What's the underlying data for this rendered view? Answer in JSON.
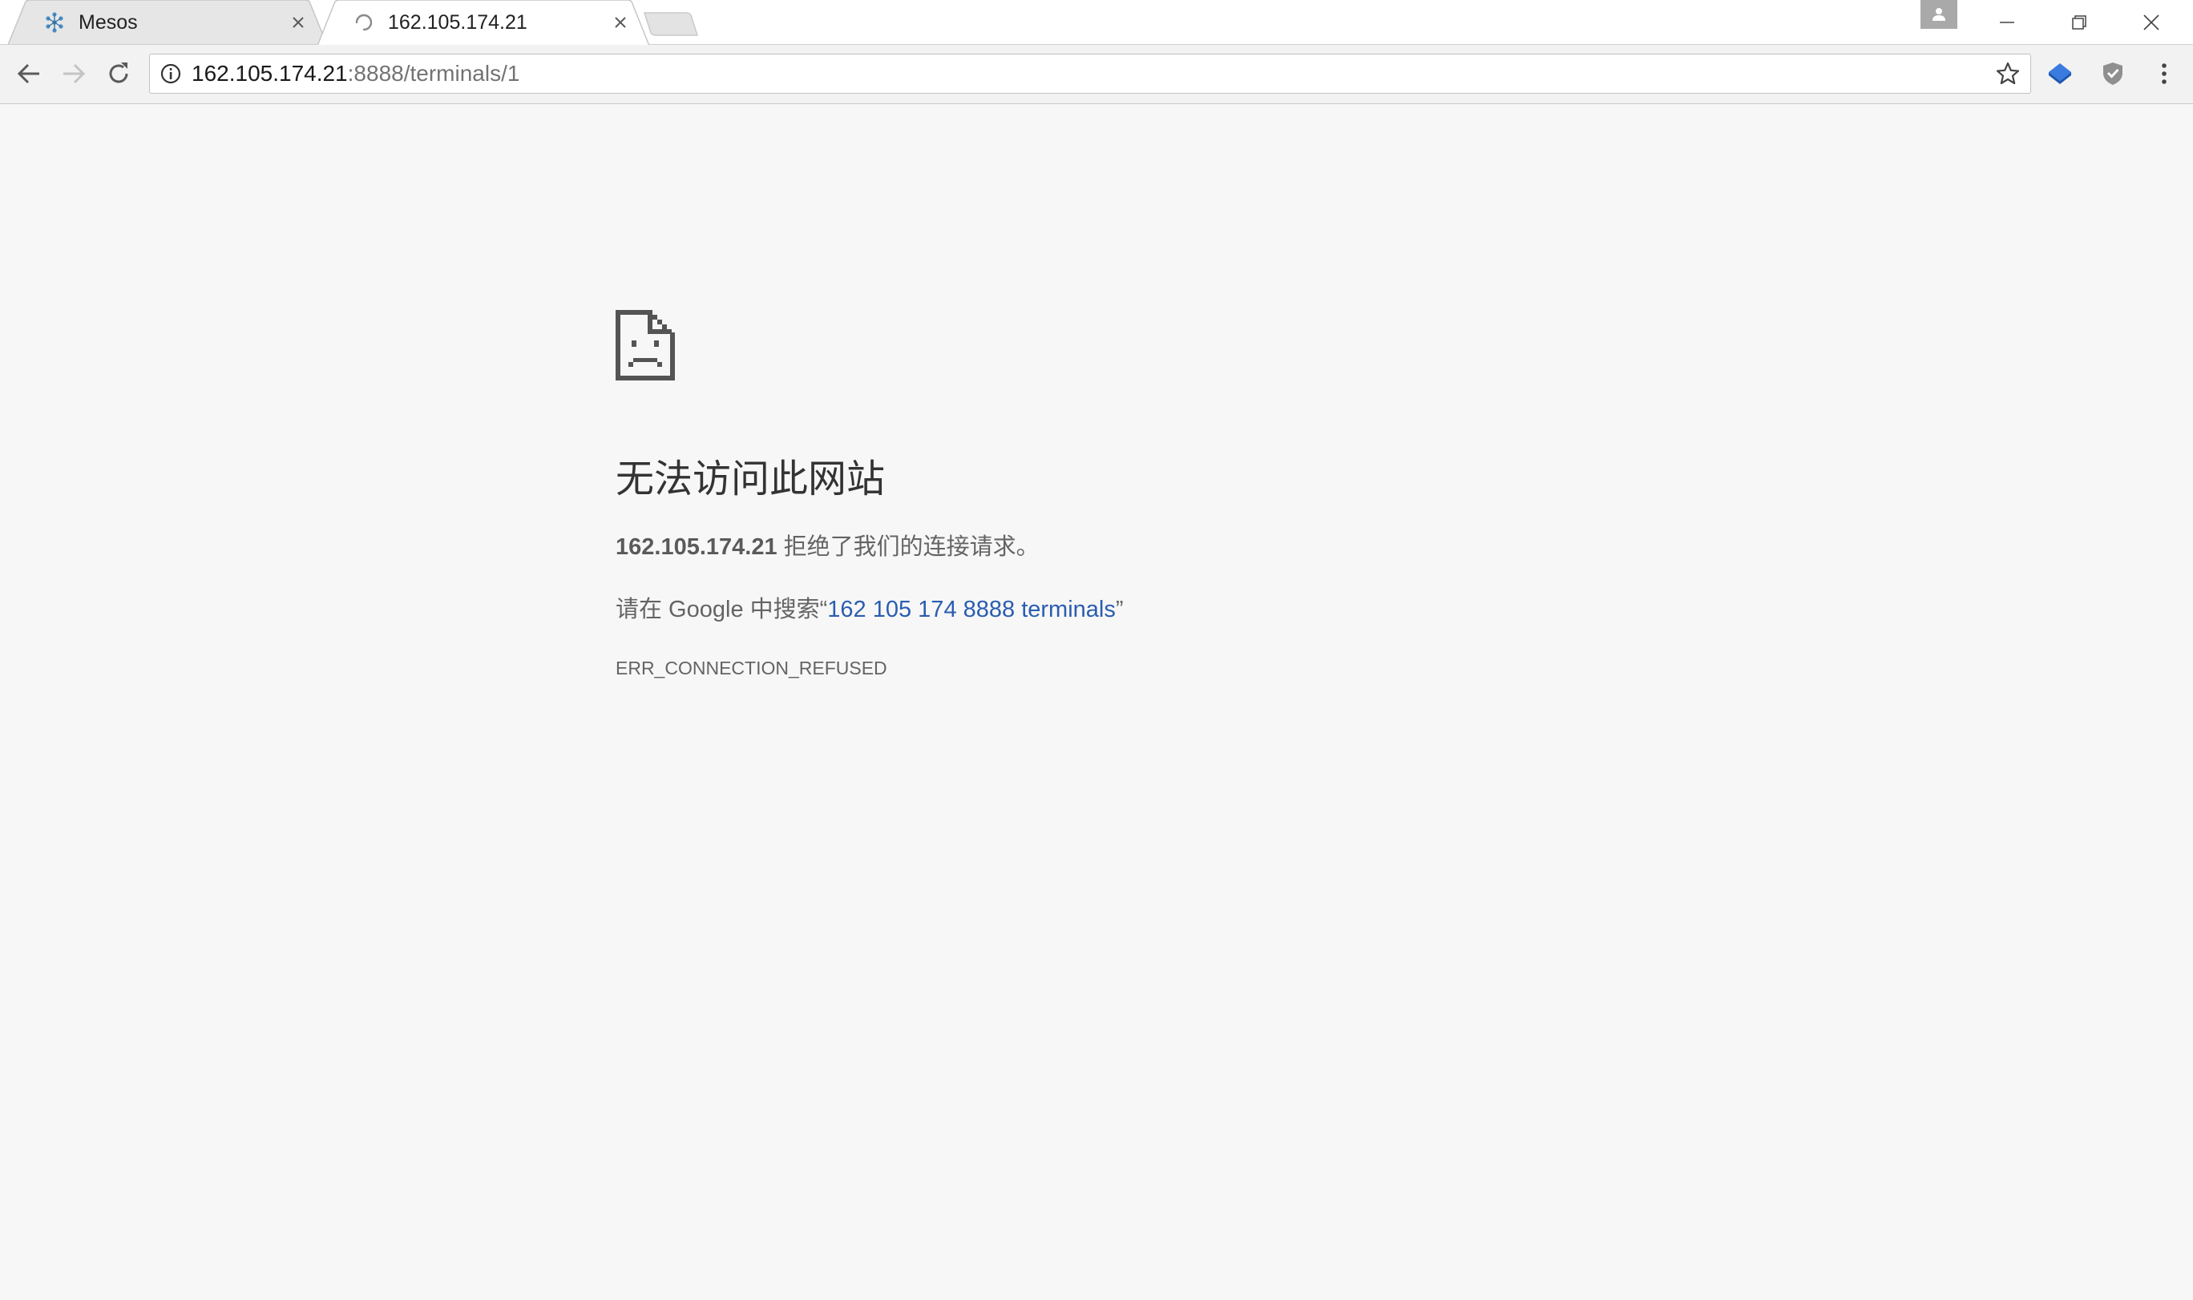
{
  "tabs": [
    {
      "title": "Mesos",
      "icon": "mesos-favicon",
      "active": false
    },
    {
      "title": "162.105.174.21",
      "icon": "loading-spinner-icon",
      "active": true
    }
  ],
  "toolbar": {
    "url_host": "162.105.174.21",
    "url_rest": ":8888/terminals/1"
  },
  "error": {
    "title": "无法访问此网站",
    "host": "162.105.174.21",
    "summary_rest": " 拒绝了我们的连接请求。",
    "suggest_prefix": "请在 Google 中搜索“",
    "suggest_link": "162 105 174 8888 terminals",
    "suggest_suffix": "”",
    "code": "ERR_CONNECTION_REFUSED"
  },
  "colors": {
    "link": "#2a5db0",
    "text": "#646464",
    "title": "#333333",
    "background": "#f7f7f7"
  }
}
